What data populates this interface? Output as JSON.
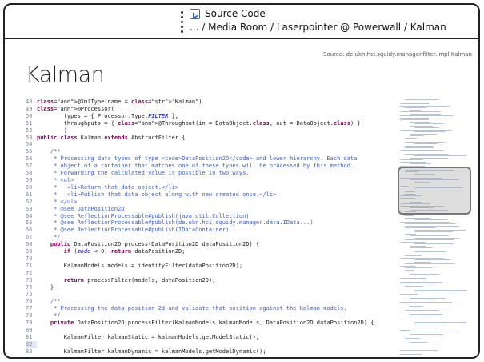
{
  "header": {
    "breadcrumb_title": "Source Code",
    "breadcrumb_path": "... / Media Room / Laserpointer @ Powerwall / Kalman"
  },
  "page": {
    "source": "Source: de.ukn.hci.squidy.manager.filter.impl.Kalman",
    "title": "Kalman"
  },
  "code_lines": [
    {
      "n": "48",
      "t": "@XmlType(name = \"Kalman\")"
    },
    {
      "n": "49",
      "t": "@Processor("
    },
    {
      "n": "50",
      "t": "        types = { Processor.Type.FILTER },"
    },
    {
      "n": "51",
      "t": "        throughputs = { @Throughput(in = DataObject.class, out = DataObject.class) }"
    },
    {
      "n": "52",
      "t": "        )"
    },
    {
      "n": "53",
      "t": "public class Kalman extends AbstractFilter {"
    },
    {
      "n": "54",
      "t": ""
    },
    {
      "n": "55",
      "t": "    /**"
    },
    {
      "n": "56",
      "t": "     * Processing data types of type <code>DataPosition2D</code> and lower hierarchy. Each data"
    },
    {
      "n": "57",
      "t": "     * object of a container that matches one of these types will be processed by this method."
    },
    {
      "n": "58",
      "t": "     * Forwarding the calculated value is possible in two ways."
    },
    {
      "n": "59",
      "t": "     * <ul>"
    },
    {
      "n": "60",
      "t": "     *   <li>Return that data object.</li>"
    },
    {
      "n": "61",
      "t": "     *   <li>Publish that data object along with new created once.</li>"
    },
    {
      "n": "62",
      "t": "     * </ul>"
    },
    {
      "n": "63",
      "t": "     * @see DataPosition2D"
    },
    {
      "n": "64",
      "t": "     * @see ReflectionProcessable#publish(java.util.Collection)"
    },
    {
      "n": "65",
      "t": "     * @see ReflectionProcessable#publish(de.ukn.hci.squidy.manager.data.IData...)"
    },
    {
      "n": "66",
      "t": "     * @see ReflectionProcessable#publish(IDataContainer)"
    },
    {
      "n": "67",
      "t": "     */"
    },
    {
      "n": "68",
      "t": "    public DataPosition2D process(DataPosition2D dataPosition2D) {"
    },
    {
      "n": "69",
      "t": "        if (mode < 0) return dataPosition2D;"
    },
    {
      "n": "70",
      "t": ""
    },
    {
      "n": "71",
      "t": "        KalmanModels models = identifyFilter(dataPosition2D);"
    },
    {
      "n": "72",
      "t": ""
    },
    {
      "n": "73",
      "t": "        return processFilter(models, dataPosition2D);"
    },
    {
      "n": "74",
      "t": "    }"
    },
    {
      "n": "75",
      "t": ""
    },
    {
      "n": "76",
      "t": "    /**"
    },
    {
      "n": "77",
      "t": "     * Processing the data position 2d and validate that position against the Kalman models."
    },
    {
      "n": "78",
      "t": "     */"
    },
    {
      "n": "79",
      "t": "    private DataPosition2D processFilter(KalmanModels kalmanModels, DataPosition2D dataPosition2D) {"
    },
    {
      "n": "80",
      "t": ""
    },
    {
      "n": "81",
      "t": "        KalmanFilter kalmanStatic = kalmanModels.getModelStatic();"
    },
    {
      "n": "82",
      "t": ""
    },
    {
      "n": "83",
      "t": "        KalmanFilter kalmanDynamic = kalmanModels.getModelDynamic();"
    }
  ],
  "icons": {
    "breadcrumb_icon": "source-code-icon",
    "menu": "vertical-dots-icon"
  }
}
